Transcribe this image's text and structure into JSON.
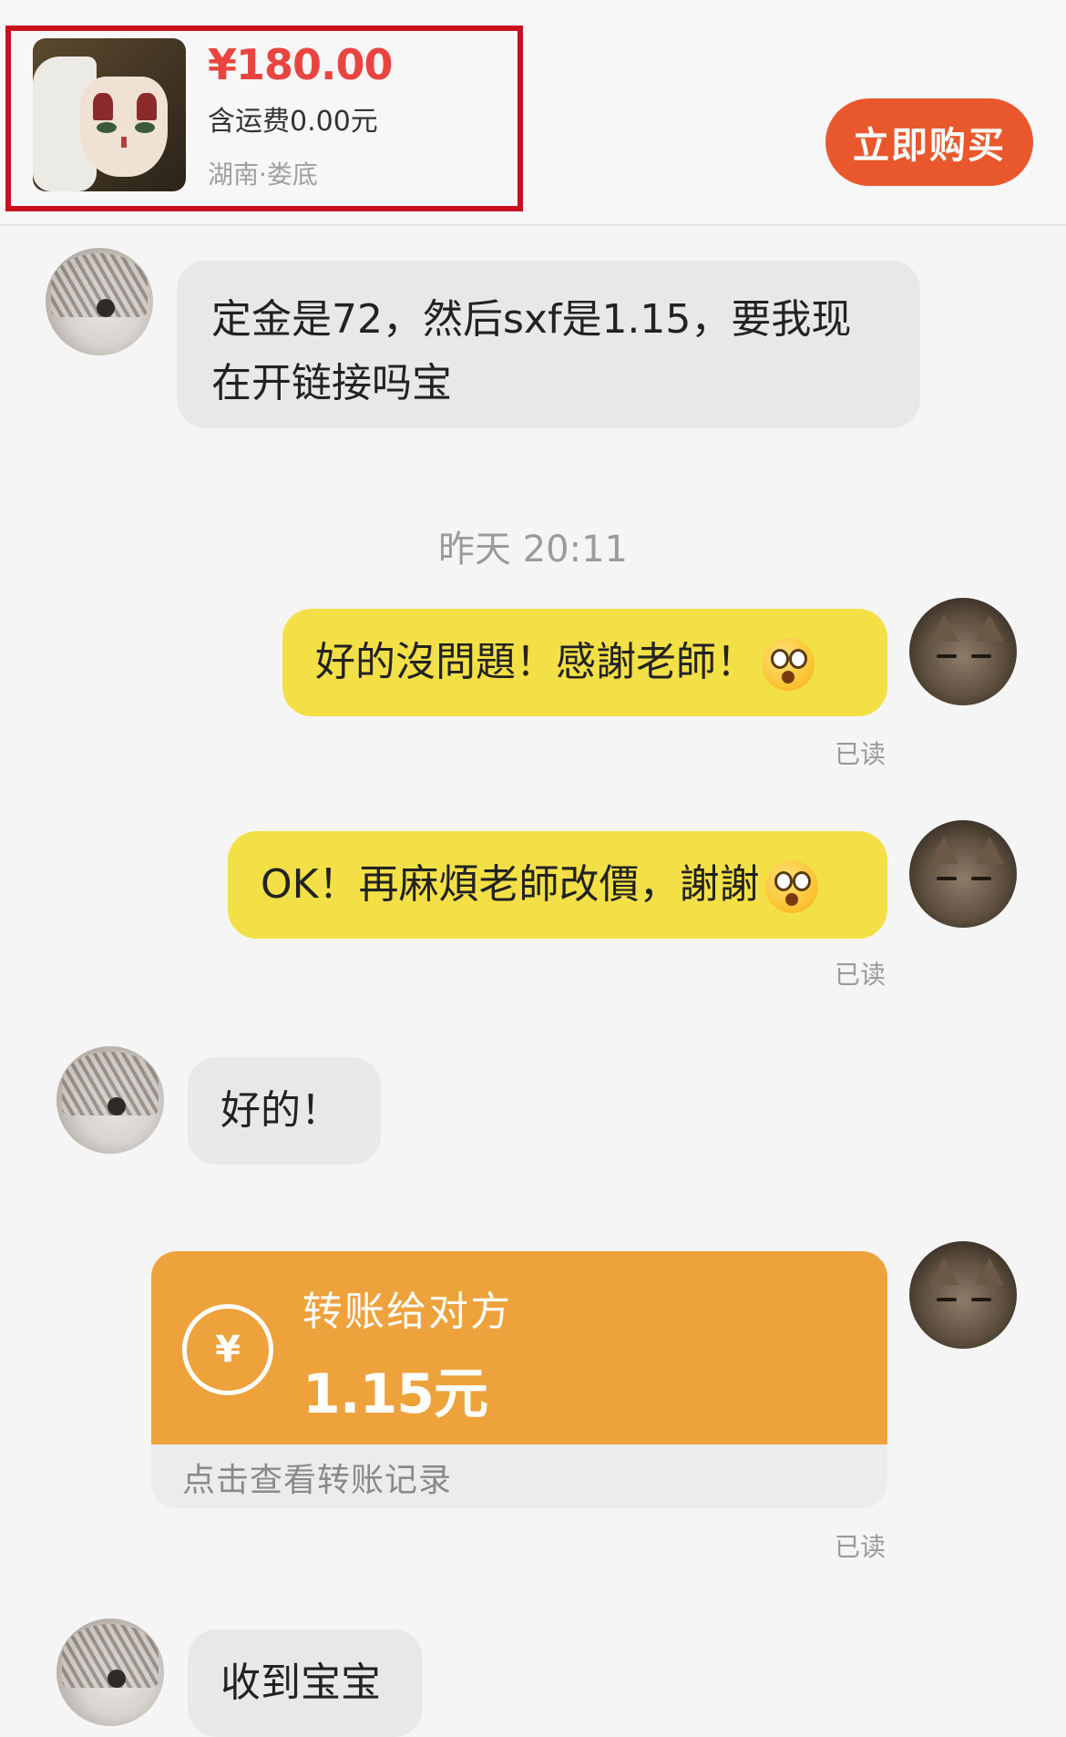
{
  "product": {
    "price": "¥180.00",
    "shipping": "含运费0.00元",
    "location": "湖南·娄底",
    "buy_button": "立即购买"
  },
  "timestamp": "昨天 20:11",
  "messages": [
    {
      "sender": "seller",
      "lines": [
        "定金是72，然后sxf是1.15，要我现",
        "在开链接吗宝"
      ]
    },
    {
      "sender": "me",
      "text": "好的沒問題！感謝老師！",
      "emoji": "pleading-face",
      "status": "已读"
    },
    {
      "sender": "me",
      "text": "OK！再麻煩老師改價，謝謝",
      "emoji": "pleading-face",
      "status": "已读"
    },
    {
      "sender": "seller",
      "text": "好的！"
    },
    {
      "sender": "seller",
      "text": "收到宝宝"
    }
  ],
  "transfer": {
    "title": "转账给对方",
    "amount": "1.15元",
    "link": "点击查看转账记录",
    "status": "已读",
    "icon": "yuan-transfer-icon"
  },
  "colors": {
    "price_red": "#e94440",
    "buy_orange": "#e9582c",
    "highlight_red": "#c8101d",
    "my_bubble": "#f3e046",
    "their_bubble": "#e8e8e8",
    "transfer_orange": "#eea23c"
  }
}
